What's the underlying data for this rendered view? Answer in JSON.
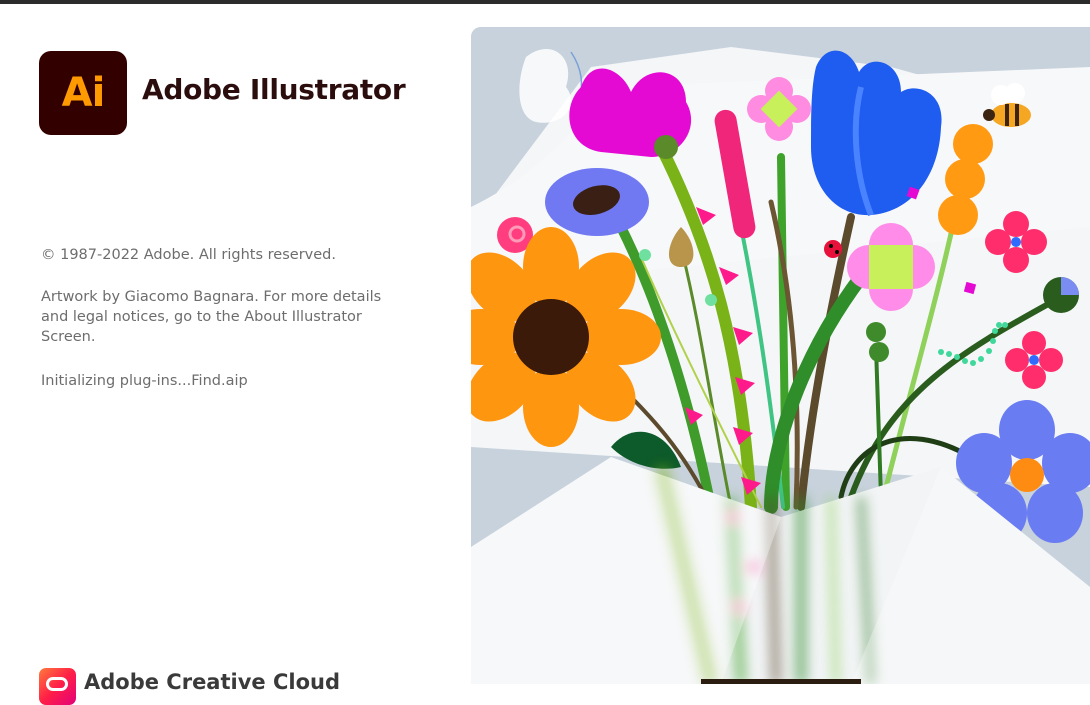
{
  "app": {
    "logo_letters": "Ai",
    "title": "Adobe Illustrator",
    "brand_colors": {
      "logo_background": "#330000",
      "logo_text": "#ff9a00"
    }
  },
  "info": {
    "copyright": "© 1987-2022 Adobe. All rights reserved.",
    "credits": "Artwork by Giacomo Bagnara. For more details and legal notices, go to the About Illustrator Screen.",
    "status": "Initializing plug-ins...Find.aip"
  },
  "footer": {
    "label": "Adobe Creative Cloud",
    "icon": "creative-cloud-icon"
  },
  "artwork": {
    "icon": "flower-bouquet-illustration"
  }
}
